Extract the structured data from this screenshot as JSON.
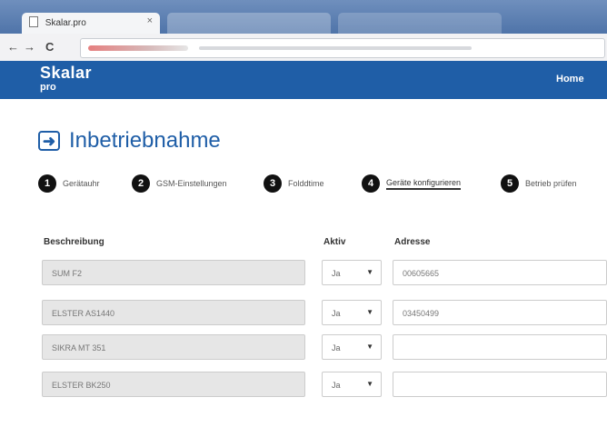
{
  "browser": {
    "tab_title": "Skalar.pro",
    "tab_close": "×",
    "back": "←",
    "forward": "→",
    "reload": "C"
  },
  "app": {
    "brand_line1": "Skalar",
    "brand_line2": "pro",
    "nav_home": "Home"
  },
  "page": {
    "heading": "Inbetriebnahme",
    "heading_icon": "arrow-right-box-icon",
    "steps": [
      {
        "num": "1",
        "label": "Gerätauhr",
        "active": false
      },
      {
        "num": "2",
        "label": "GSM-Einstellungen",
        "active": false
      },
      {
        "num": "3",
        "label": "Folddtime",
        "active": false
      },
      {
        "num": "4",
        "label": "Geräte konfigurieren",
        "active": true
      },
      {
        "num": "5",
        "label": "Betrieb prüfen",
        "active": false
      }
    ],
    "table": {
      "headers": {
        "beschreibung": "Beschreibung",
        "aktiv": "Aktiv",
        "adresse": "Adresse"
      },
      "rows": [
        {
          "beschreibung": "SUM F2",
          "aktiv": "Ja",
          "adresse": "00605665"
        },
        {
          "beschreibung": "ELSTER AS1440",
          "aktiv": "Ja",
          "adresse": "03450499"
        },
        {
          "beschreibung": "SIKRA MT 351",
          "aktiv": "Ja",
          "adresse": ""
        },
        {
          "beschreibung": "ELSTER BK250",
          "aktiv": "Ja",
          "adresse": ""
        }
      ]
    }
  },
  "colors": {
    "brand_blue": "#1f5ea7",
    "step_dark": "#111111"
  }
}
